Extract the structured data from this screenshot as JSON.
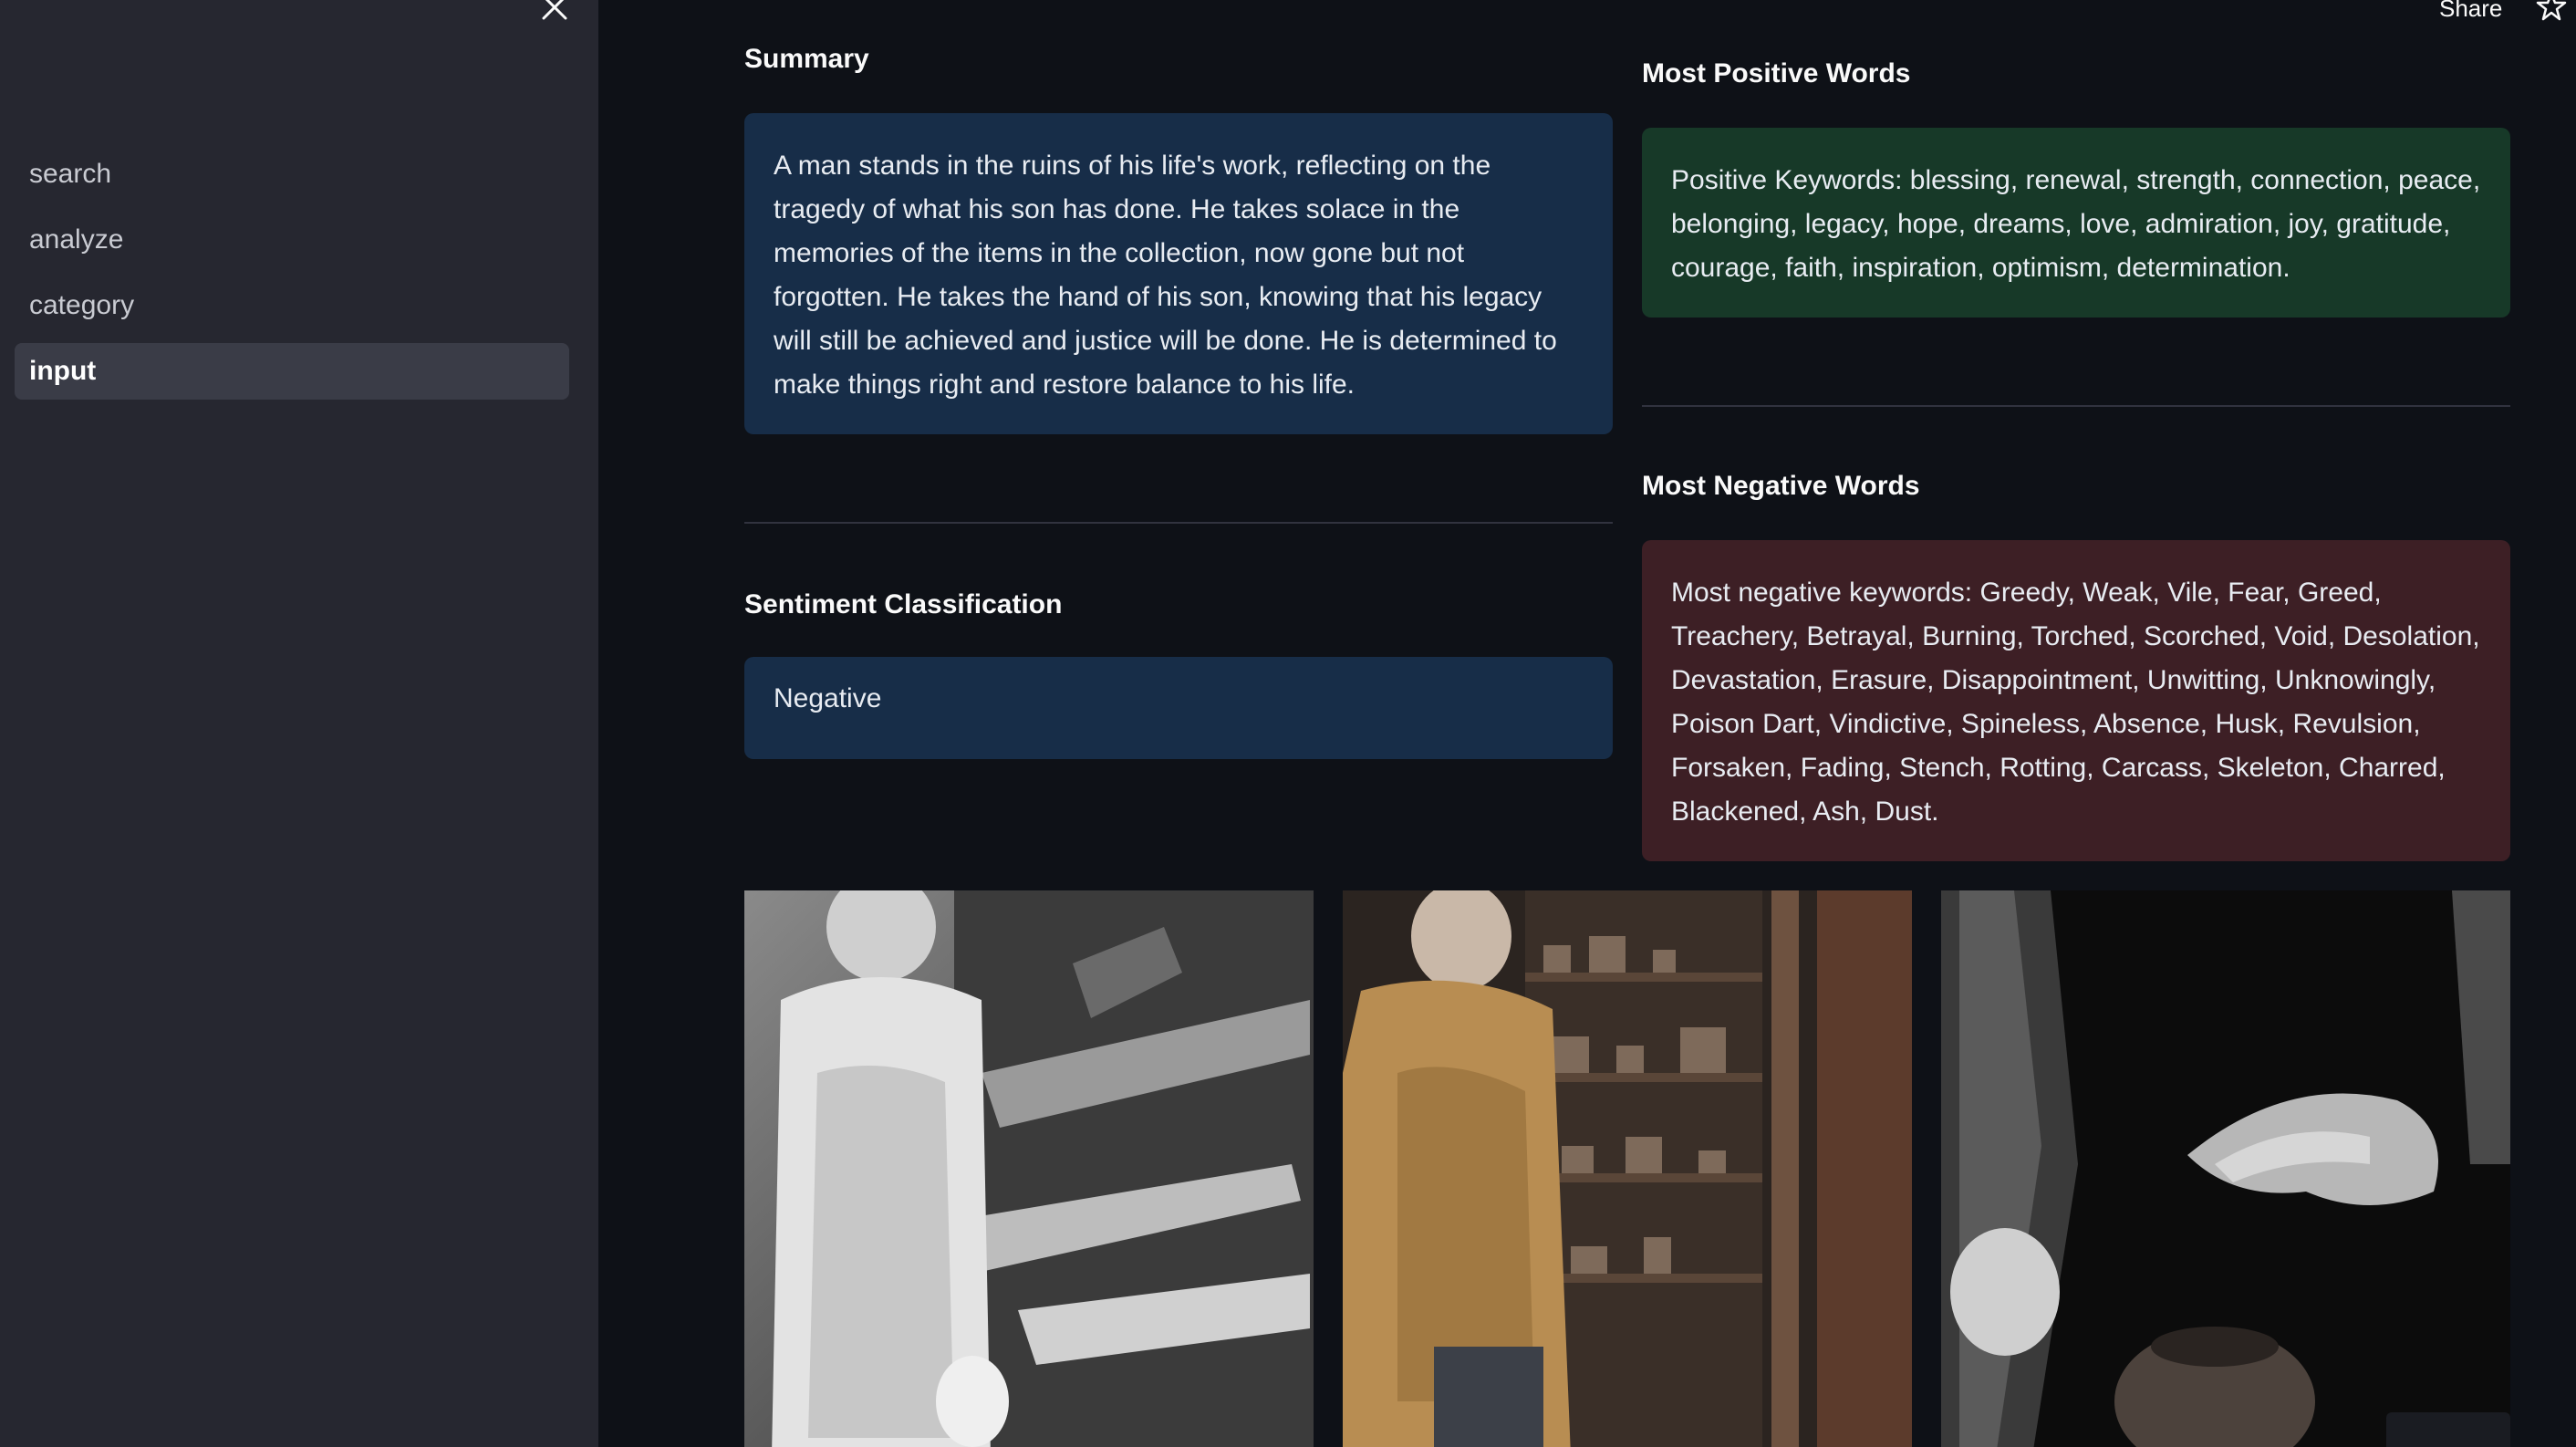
{
  "sidebar": {
    "items": [
      {
        "label": "search"
      },
      {
        "label": "analyze"
      },
      {
        "label": "category"
      },
      {
        "label": "input",
        "active": true
      }
    ]
  },
  "header": {
    "share_label": "Share"
  },
  "summary": {
    "heading": "Summary",
    "text": "A man stands in the ruins of his life's work, reflecting on the tragedy of what his son has done. He takes solace in the memories of the items in the collection, now gone but not forgotten. He takes the hand of his son, knowing that his legacy will still be achieved and justice will be done. He is determined to make things right and restore balance to his life."
  },
  "sentiment": {
    "heading": "Sentiment Classification",
    "value": "Negative"
  },
  "positive": {
    "heading": "Most Positive Words",
    "text": "Positive Keywords: blessing, renewal, strength, connection, peace, belonging, legacy, hope, dreams, love, admiration, joy, gratitude, courage, faith, inspiration, optimism, determination."
  },
  "negative": {
    "heading": "Most Negative Words",
    "text": "Most negative keywords: Greedy, Weak, Vile, Fear, Greed, Treachery, Betrayal, Burning, Torched, Scorched, Void, Desolation, Devastation, Erasure, Disappointment, Unwitting, Unknowingly, Poison Dart, Vindictive, Spineless, Absence, Husk, Revulsion, Forsaken, Fading, Stench, Rotting, Carcass, Skeleton, Charred, Blackened, Ash, Dust."
  },
  "colors": {
    "background": "#0e1117",
    "sidebar": "#262730",
    "info_blue": "#172d48",
    "success_green": "#173928",
    "error_red": "#3d1f25"
  }
}
